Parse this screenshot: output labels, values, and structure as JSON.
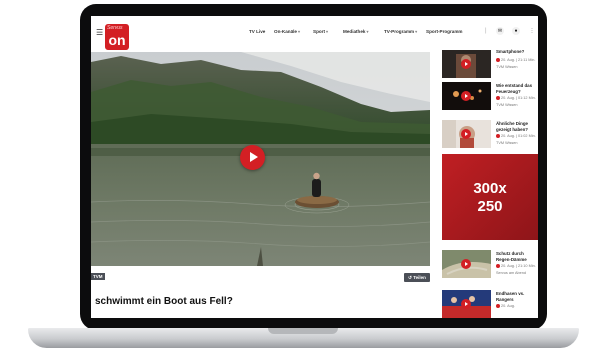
{
  "header": {
    "logo_script": "Servus",
    "logo_text": "on",
    "nav": [
      "TV Live",
      "On-Kanäle",
      "Sport",
      "Mediathek",
      "TV-Programm",
      "Sport-Programm"
    ]
  },
  "video": {
    "source_tag": "TVM",
    "share_label": "Teilen",
    "headline": "schwimmt ein Boot aus Fell?"
  },
  "sidebar": {
    "items": [
      {
        "title": "Smartphone?",
        "date": "20. Aug. | 21:11 Min.",
        "source": "TVM Wissen"
      },
      {
        "title": "Wie entstand das Feuerzeug?",
        "date": "20. Aug. | 01:12 Min.",
        "source": "TVM Wissen"
      },
      {
        "title": "Ähnliche Dinge gezeigt haben?",
        "date": "20. Aug. | 01:02 Min.",
        "source": "TVM Wissen"
      },
      {
        "title": "Schutz durch Regen-Dämme",
        "date": "20. Aug. | 21:10 Min.",
        "source": "Servus am Abend"
      },
      {
        "title": "Endhasen vs. Rangers",
        "date": "20. Aug.",
        "source": ""
      }
    ],
    "ad_line1": "300x",
    "ad_line2": "250"
  },
  "icons": {
    "menu": "menu-icon",
    "play": "play-icon",
    "share": "share-icon",
    "mail": "mail-icon",
    "user": "user-icon",
    "more": "more-icon"
  },
  "colors": {
    "brand": "#d31f24",
    "ad": "#a81b20"
  }
}
